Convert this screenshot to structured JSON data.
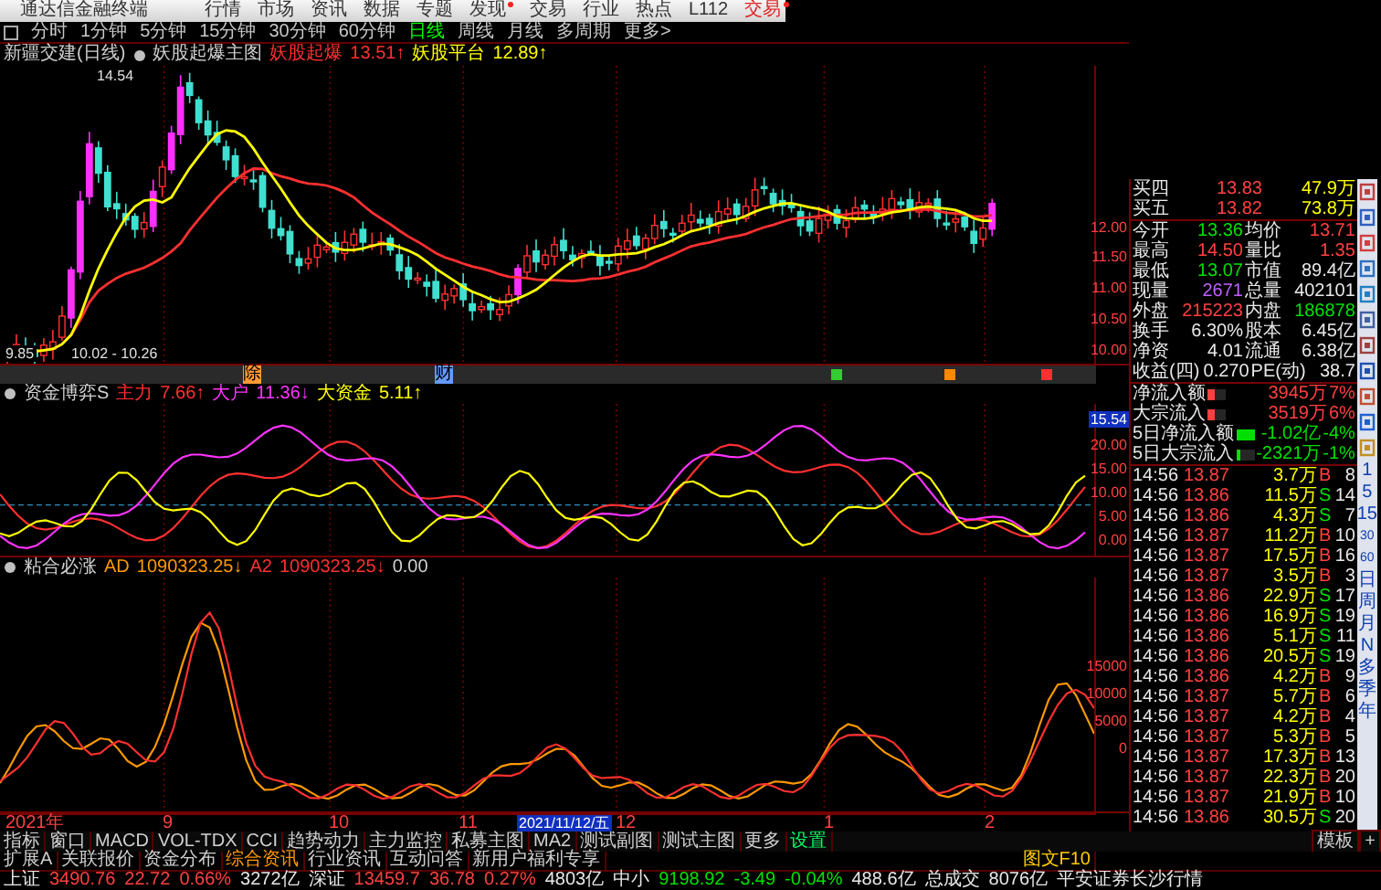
{
  "menu": {
    "app_name": "通达信金融终端",
    "items": [
      {
        "label": "行情",
        "badge": false
      },
      {
        "label": "市场",
        "badge": false
      },
      {
        "label": "资讯",
        "badge": false
      },
      {
        "label": "数据",
        "badge": false
      },
      {
        "label": "专题",
        "badge": false
      },
      {
        "label": "发现",
        "badge": true
      },
      {
        "label": "交易",
        "badge": false
      },
      {
        "label": "行业",
        "badge": false
      },
      {
        "label": "热点",
        "badge": false
      },
      {
        "label": "L112",
        "badge": false
      }
    ],
    "trade": {
      "label": "交易",
      "badge": true
    }
  },
  "period_tabs": [
    {
      "label": "分时",
      "selected": false
    },
    {
      "label": "1分钟",
      "selected": false
    },
    {
      "label": "5分钟",
      "selected": false
    },
    {
      "label": "15分钟",
      "selected": false
    },
    {
      "label": "30分钟",
      "selected": false
    },
    {
      "label": "60分钟",
      "selected": false
    },
    {
      "label": "日线",
      "selected": true
    },
    {
      "label": "周线",
      "selected": false
    },
    {
      "label": "月线",
      "selected": false
    },
    {
      "label": "多周期",
      "selected": false
    },
    {
      "label": "更多>",
      "selected": false
    }
  ],
  "main_chart": {
    "title": "新疆交建(日线)",
    "indicator": "妖股起爆主图",
    "series": [
      {
        "name": "妖股起爆",
        "value": "13.51↑",
        "color": "#ff3030"
      },
      {
        "name": "妖股平台",
        "value": "12.89↑",
        "color": "#ffff00"
      }
    ],
    "high_label": "14.54",
    "low_label": "9.85",
    "range_label": "10.02 - 10.26",
    "axis_labels": [
      "12.00",
      "11.50",
      "11.00",
      "10.50",
      "10.00"
    ]
  },
  "event_markers": [
    {
      "kind": "text",
      "label": "除",
      "color": "#ff9933"
    },
    {
      "kind": "text",
      "label": "财",
      "color": "#6699ff"
    },
    {
      "kind": "block",
      "color": "#33cc33"
    },
    {
      "kind": "block",
      "color": "#ff8800"
    },
    {
      "kind": "block",
      "color": "#ff3030"
    }
  ],
  "fund_chart": {
    "title": "资金博弈S",
    "series": [
      {
        "name": "主力",
        "value": "7.66↑",
        "color": "#ff3030"
      },
      {
        "name": "大户",
        "value": "11.36↓",
        "color": "#ff33ff"
      },
      {
        "name": "大资金",
        "value": "5.11↑",
        "color": "#ffff00"
      }
    ],
    "cursor_label": "15.54",
    "axis_labels": [
      "20.00",
      "15.00",
      "10.00",
      "5.00",
      "0.00"
    ]
  },
  "adhesion_chart": {
    "title": "粘合必涨",
    "series": [
      {
        "name": "AD",
        "value": "1090323.25↓",
        "color": "#ff9900"
      },
      {
        "name": "A2",
        "value": "1090323.25↓",
        "color": "#ff3030"
      }
    ],
    "extra": "0.00",
    "axis_labels": [
      "15000",
      "10000",
      "5000",
      "0"
    ]
  },
  "date_axis": [
    {
      "label": "2021年",
      "selected": false
    },
    {
      "label": "9",
      "selected": false
    },
    {
      "label": "10",
      "selected": false
    },
    {
      "label": "11",
      "selected": false
    },
    {
      "label": "2021/11/12/五",
      "selected": true
    },
    {
      "label": "12",
      "selected": false
    },
    {
      "label": "1",
      "selected": false
    },
    {
      "label": "2",
      "selected": false
    }
  ],
  "quote_panel": {
    "order_book": [
      {
        "label": "买四",
        "price": "13.83",
        "volume": "47.9万"
      },
      {
        "label": "买五",
        "price": "13.82",
        "volume": "73.8万"
      }
    ],
    "stats": [
      {
        "cells": [
          {
            "label": "今开",
            "value": "13.36",
            "color": "#00e000"
          },
          {
            "label": "均价",
            "value": "13.71",
            "color": "#ff4040"
          }
        ]
      },
      {
        "cells": [
          {
            "label": "最高",
            "value": "14.50",
            "color": "#ff4040"
          },
          {
            "label": "量比",
            "value": "1.35",
            "color": "#ff4040"
          }
        ]
      },
      {
        "cells": [
          {
            "label": "最低",
            "value": "13.07",
            "color": "#00e000"
          },
          {
            "label": "市值",
            "value": "89.4亿",
            "color": "#e8e8e8"
          }
        ]
      },
      {
        "cells": [
          {
            "label": "现量",
            "value": "2671",
            "color": "#c060ff"
          },
          {
            "label": "总量",
            "value": "402101",
            "color": "#e8e8e8"
          }
        ]
      },
      {
        "cells": [
          {
            "label": "外盘",
            "value": "215223",
            "color": "#ff4040"
          },
          {
            "label": "内盘",
            "value": "186878",
            "color": "#00e000"
          }
        ]
      },
      {
        "cells": [
          {
            "label": "换手",
            "value": "6.30%",
            "color": "#e8e8e8"
          },
          {
            "label": "股本",
            "value": "6.45亿",
            "color": "#e8e8e8"
          }
        ]
      },
      {
        "cells": [
          {
            "label": "净资",
            "value": "4.01",
            "color": "#e8e8e8"
          },
          {
            "label": "流通",
            "value": "6.38亿",
            "color": "#e8e8e8"
          }
        ]
      },
      {
        "cells": [
          {
            "label": "收益(四)",
            "value": "0.270",
            "color": "#e8e8e8"
          },
          {
            "label": "PE(动)",
            "value": "38.7",
            "color": "#e8e8e8"
          }
        ]
      }
    ],
    "flows": [
      {
        "label": "净流入额",
        "value": "3945万",
        "pct": "7%",
        "color": "#ff4040",
        "level": 0.4
      },
      {
        "label": "大宗流入",
        "value": "3519万",
        "pct": "6%",
        "color": "#ff4040",
        "level": 0.4
      },
      {
        "label": "5日净流入额",
        "value": "-1.02亿",
        "pct": "-4%",
        "color": "#00e000",
        "level": 1
      },
      {
        "label": "5日大宗流入",
        "value": "-2321万",
        "pct": "-1%",
        "color": "#00e000",
        "level": 0.25
      }
    ],
    "ticks": [
      {
        "time": "14:56",
        "price": "13.87",
        "volume": "3.7万",
        "side": "B",
        "kind": "buy",
        "count": "8"
      },
      {
        "time": "14:56",
        "price": "13.86",
        "volume": "11.5万",
        "side": "S",
        "kind": "sell",
        "count": "14"
      },
      {
        "time": "14:56",
        "price": "13.86",
        "volume": "4.3万",
        "side": "S",
        "kind": "sell",
        "count": "7"
      },
      {
        "time": "14:56",
        "price": "13.87",
        "volume": "11.2万",
        "side": "B",
        "kind": "buy",
        "count": "10"
      },
      {
        "time": "14:56",
        "price": "13.87",
        "volume": "17.5万",
        "side": "B",
        "kind": "buy",
        "count": "16"
      },
      {
        "time": "14:56",
        "price": "13.87",
        "volume": "3.5万",
        "side": "B",
        "kind": "buy",
        "count": "3"
      },
      {
        "time": "14:56",
        "price": "13.86",
        "volume": "22.9万",
        "side": "S",
        "kind": "sell",
        "count": "17"
      },
      {
        "time": "14:56",
        "price": "13.86",
        "volume": "16.9万",
        "side": "S",
        "kind": "sell",
        "count": "19"
      },
      {
        "time": "14:56",
        "price": "13.86",
        "volume": "5.1万",
        "side": "S",
        "kind": "sell",
        "count": "11"
      },
      {
        "time": "14:56",
        "price": "13.86",
        "volume": "20.5万",
        "side": "S",
        "kind": "sell",
        "count": "19"
      },
      {
        "time": "14:56",
        "price": "13.86",
        "volume": "4.2万",
        "side": "B",
        "kind": "buy",
        "count": "9"
      },
      {
        "time": "14:56",
        "price": "13.87",
        "volume": "5.7万",
        "side": "B",
        "kind": "buy",
        "count": "6"
      },
      {
        "time": "14:56",
        "price": "13.87",
        "volume": "4.2万",
        "side": "B",
        "kind": "buy",
        "count": "4"
      },
      {
        "time": "14:56",
        "price": "13.87",
        "volume": "5.3万",
        "side": "B",
        "kind": "buy",
        "count": "5"
      },
      {
        "time": "14:56",
        "price": "13.87",
        "volume": "17.3万",
        "side": "B",
        "kind": "buy",
        "count": "13"
      },
      {
        "time": "14:56",
        "price": "13.87",
        "volume": "22.3万",
        "side": "B",
        "kind": "buy",
        "count": "20"
      },
      {
        "time": "14:56",
        "price": "13.87",
        "volume": "21.9万",
        "side": "B",
        "kind": "buy",
        "count": "10"
      },
      {
        "time": "14:56",
        "price": "13.86",
        "volume": "30.5万",
        "side": "S",
        "kind": "sell",
        "count": "20"
      }
    ]
  },
  "side_toolbar": [
    "1",
    "5",
    "15",
    "30",
    "60",
    "日",
    "周",
    "月",
    "N",
    "多",
    "季",
    "年"
  ],
  "indicator_tabs": [
    {
      "label": "指标",
      "highlight": false
    },
    {
      "label": "窗口",
      "highlight": false
    },
    {
      "label": "MACD",
      "highlight": false
    },
    {
      "label": "VOL-TDX",
      "highlight": false
    },
    {
      "label": "CCI",
      "highlight": false
    },
    {
      "label": "趋势动力",
      "highlight": false
    },
    {
      "label": "主力监控",
      "highlight": false
    },
    {
      "label": "私募主图",
      "highlight": false
    },
    {
      "label": "MA2",
      "highlight": false
    },
    {
      "label": "测试副图",
      "highlight": false
    },
    {
      "label": "测试主图",
      "highlight": false
    },
    {
      "label": "更多",
      "highlight": false
    },
    {
      "label": "设置",
      "highlight": true
    }
  ],
  "template_button": "模板",
  "add_button": "+",
  "info_tabs": [
    {
      "label": "扩展A",
      "highlight": false
    },
    {
      "label": "关联报价",
      "highlight": false
    },
    {
      "label": "资金分布",
      "highlight": false
    },
    {
      "label": "综合资讯",
      "highlight": true
    },
    {
      "label": "行业资讯",
      "highlight": false
    },
    {
      "label": "互动问答",
      "highlight": false
    },
    {
      "label": "新用户福利专享",
      "highlight": false
    }
  ],
  "f10_button": "图文F10",
  "status_bar": {
    "indices": [
      {
        "name": "上证",
        "price": "3490.76",
        "change": "22.72",
        "pct": "0.66%",
        "amount": "3272亿",
        "color": "#ff4040"
      },
      {
        "name": "深证",
        "price": "13459.7",
        "change": "36.78",
        "pct": "0.27%",
        "amount": "4803亿",
        "color": "#ff4040"
      },
      {
        "name": "中小",
        "price": "9198.92",
        "change": "-3.49",
        "pct": "-0.04%",
        "amount": "488.6亿",
        "color": "#00e000"
      }
    ],
    "total_label": "总成交",
    "total": "8076亿",
    "broker": "平安证券长沙行情"
  }
}
